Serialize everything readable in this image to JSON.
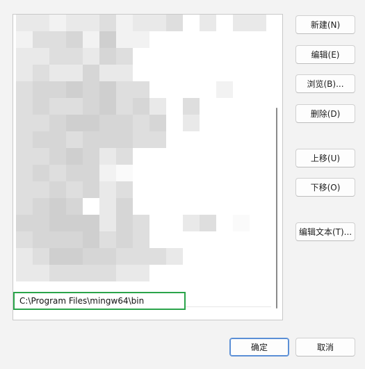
{
  "env_list": {
    "selected_path": "C:\\Program Files\\mingw64\\bin",
    "blur_colors": [
      "#f2f2f2",
      "#e9e9e9",
      "#dedede",
      "#d6d6d6",
      "#cfcfcf",
      "#fafafa",
      "#ffffff"
    ]
  },
  "side_buttons": {
    "new": "新建(N)",
    "edit": "编辑(E)",
    "browse": "浏览(B)...",
    "delete": "删除(D)",
    "move_up": "上移(U)",
    "move_down": "下移(O)",
    "edit_text": "编辑文本(T)..."
  },
  "footer_buttons": {
    "ok": "确定",
    "cancel": "取消"
  }
}
